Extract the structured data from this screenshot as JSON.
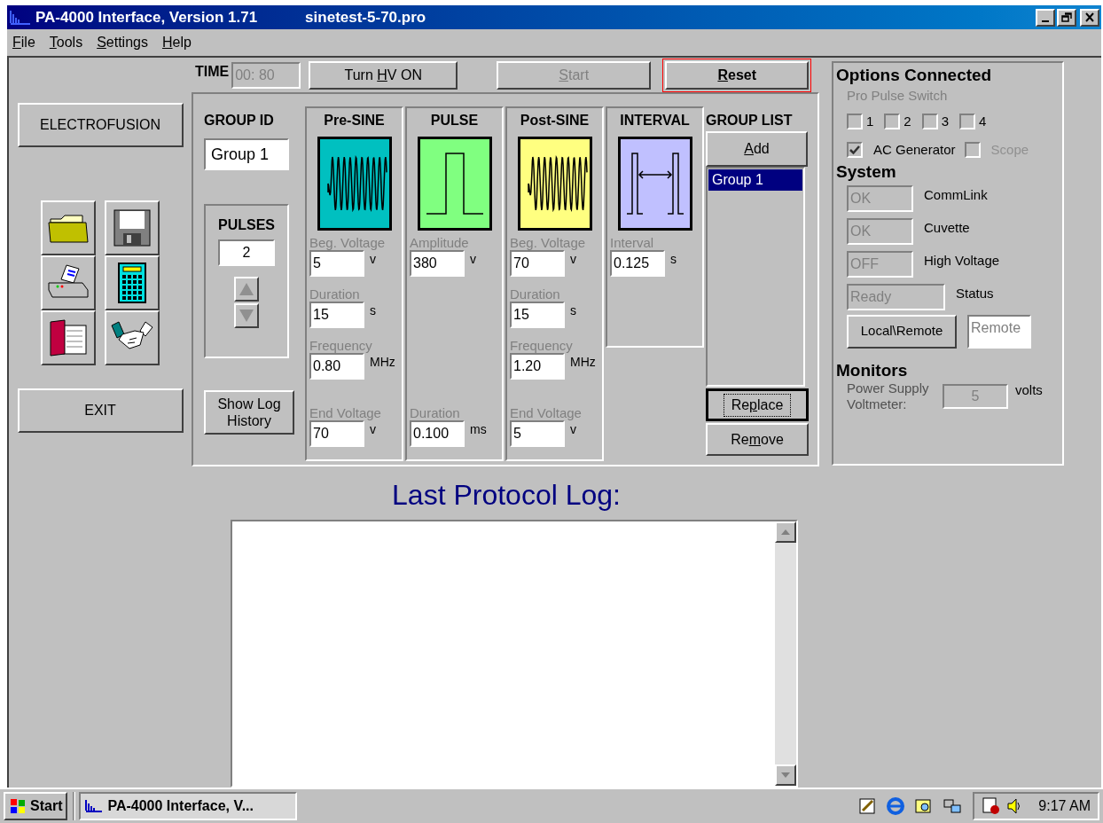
{
  "window": {
    "title": "PA-4000 Interface, Version 1.71",
    "file": "sinetest-5-70.pro"
  },
  "menu": [
    {
      "key": "F",
      "post": "ile"
    },
    {
      "key": "T",
      "post": "ools"
    },
    {
      "key": "S",
      "post": "ettings"
    },
    {
      "key": "H",
      "post": "elp"
    }
  ],
  "left_panel": {
    "top_button": {
      "label": "ELECTROFUSION"
    },
    "tools": [
      {
        "kind": "folder"
      },
      {
        "kind": "disk"
      },
      {
        "kind": "printer"
      },
      {
        "kind": "calculator"
      },
      {
        "kind": "book"
      },
      {
        "kind": "handshake"
      }
    ],
    "exit_button": {
      "label": "EXIT"
    }
  },
  "time": {
    "label": "TIME",
    "value": "00: 80"
  },
  "top_buttons": [
    {
      "pre": "Turn ",
      "key": "H",
      "post": "V ON",
      "disabled": false,
      "highlighted": false
    },
    {
      "key": "S",
      "post": "tart",
      "disabled": true,
      "highlighted": false
    },
    {
      "key": "R",
      "post": "eset",
      "disabled": false,
      "highlighted": true
    }
  ],
  "group_id": {
    "label": "GROUP ID",
    "value": "Group 1"
  },
  "pulses": {
    "label": "PULSES",
    "value": "2",
    "spinner_disabled": true
  },
  "show_log_button": {
    "label": "Show Log History"
  },
  "segments": [
    {
      "title": "Pre-SINE",
      "kind": "sine",
      "color": "#00c0c0",
      "fields": [
        {
          "label": "Beg. Voltage",
          "value": "5",
          "unit": "v"
        },
        {
          "label": "Duration",
          "value": "15",
          "unit": "s"
        },
        {
          "label": "Frequency",
          "value": "0.80",
          "unit": "MHz"
        },
        {
          "label": "End Voltage",
          "value": "70",
          "unit": "v"
        }
      ]
    },
    {
      "title": "PULSE",
      "kind": "pulse",
      "color": "#80ff80",
      "fields": [
        {
          "label": "Amplitude",
          "value": "380",
          "unit": "v"
        },
        {
          "label": "Duration",
          "value": "0.100",
          "unit": "ms"
        }
      ]
    },
    {
      "title": "Post-SINE",
      "kind": "sine",
      "color": "#ffff80",
      "fields": [
        {
          "label": "Beg. Voltage",
          "value": "70",
          "unit": "v"
        },
        {
          "label": "Duration",
          "value": "15",
          "unit": "s"
        },
        {
          "label": "Frequency",
          "value": "1.20",
          "unit": "MHz"
        },
        {
          "label": "End Voltage",
          "value": "5",
          "unit": "v"
        }
      ]
    },
    {
      "title": "INTERVAL",
      "kind": "interval",
      "color": "#c0c0ff",
      "fields": [
        {
          "label": "Interval",
          "value": "0.125",
          "unit": "s"
        }
      ]
    }
  ],
  "group_list": {
    "title": "GROUP LIST",
    "add": {
      "key": "A",
      "post": "dd"
    },
    "items": [
      {
        "label": "Group 1",
        "selected": true
      }
    ],
    "replace": {
      "pre": "Re",
      "key": "p",
      "post": "lace",
      "focused": true
    },
    "remove": {
      "pre": "Re",
      "key": "m",
      "post": "ove",
      "focused": false
    }
  },
  "options": {
    "title": "Options Connected",
    "subtitle": "Pro Pulse Switch",
    "switches": [
      {
        "label": "1",
        "checked": false
      },
      {
        "label": "2",
        "checked": false
      },
      {
        "label": "3",
        "checked": false
      },
      {
        "label": "4",
        "checked": false
      }
    ],
    "extras": [
      {
        "label": "AC Generator",
        "checked": true,
        "disabled": false
      },
      {
        "label": "Scope",
        "checked": false,
        "disabled": true
      }
    ]
  },
  "system": {
    "title": "System",
    "rows": [
      {
        "value": "OK",
        "label": "CommLink",
        "kind": "narrow"
      },
      {
        "value": "OK",
        "label": "Cuvette",
        "kind": "narrow"
      },
      {
        "value": "OFF",
        "label": "High Voltage",
        "kind": "narrow"
      },
      {
        "value": "Ready",
        "label": "Status",
        "kind": "wide"
      }
    ],
    "mode_button": {
      "label": "Local\\Remote"
    },
    "mode_value": "Remote"
  },
  "monitors": {
    "title": "Monitors",
    "label": "Power Supply Voltmeter:",
    "value": "5",
    "unit": "volts"
  },
  "log": {
    "title": "Last Protocol Log:"
  },
  "taskbar": {
    "start": "Start",
    "task": "PA-4000 Interface, V...",
    "clock": "9:17 AM"
  }
}
